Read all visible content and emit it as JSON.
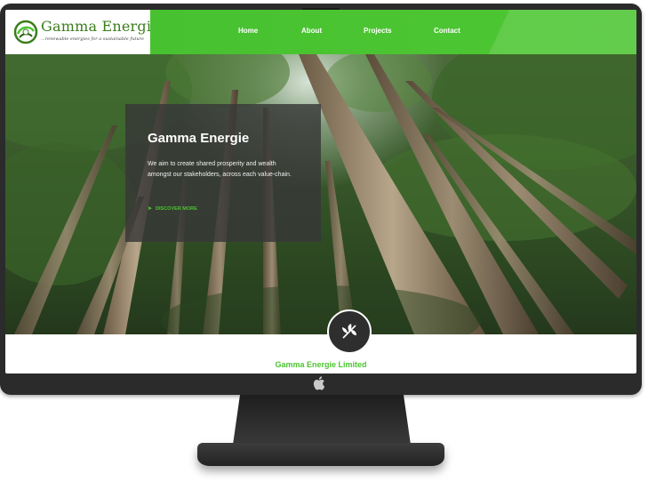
{
  "brand": {
    "name": "Gamma Energie",
    "tagline": "...renewable energies for a sustainable future",
    "logo_icon": "leaf-swirl-logo",
    "accent_color": "#4cc532"
  },
  "nav": {
    "items": [
      {
        "label": "Home"
      },
      {
        "label": "About"
      },
      {
        "label": "Projects"
      },
      {
        "label": "Contact"
      }
    ]
  },
  "hero": {
    "title": "Gamma Energie",
    "text": "We aim to create shared prosperity and wealth amongst our stakeholders, across each value-chain.",
    "cta": "DISCOVER MORE",
    "cta_icon": "arrow-right-icon"
  },
  "badge": {
    "icon": "leaf-icon"
  },
  "section": {
    "heading": "Gamma Energie Limited"
  }
}
